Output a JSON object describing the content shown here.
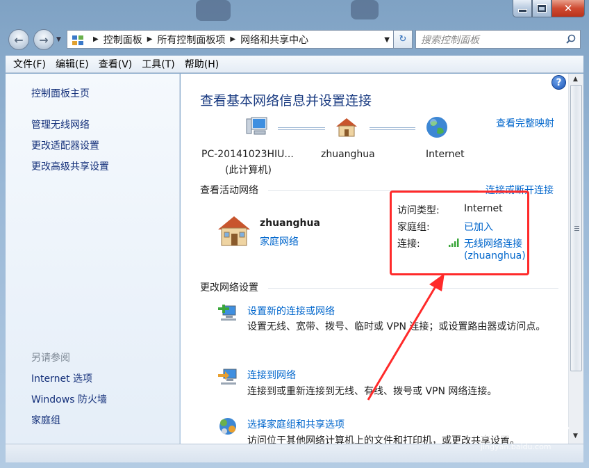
{
  "window": {
    "close_glyph": "✕"
  },
  "nav": {
    "back_glyph": "←",
    "forward_glyph": "→",
    "breadcrumbs": [
      "控制面板",
      "所有控制面板项",
      "网络和共享中心"
    ],
    "search_placeholder": "搜索控制面板",
    "refresh_glyph": "↻"
  },
  "menu": [
    "文件(F)",
    "编辑(E)",
    "查看(V)",
    "工具(T)",
    "帮助(H)"
  ],
  "sidebar": {
    "home": "控制面板主页",
    "links": [
      "管理无线网络",
      "更改适配器设置",
      "更改高级共享设置"
    ],
    "see_also_header": "另请参阅",
    "see_also": [
      "Internet 选项",
      "Windows 防火墙",
      "家庭组"
    ]
  },
  "main": {
    "title": "查看基本网络信息并设置连接",
    "full_map_link": "查看完整映射",
    "help_glyph": "?",
    "map": {
      "computer_name": "PC-20141023HIU...",
      "computer_sub": "(此计算机)",
      "network_name": "zhuanghua",
      "internet_label": "Internet"
    },
    "active": {
      "header": "查看活动网络",
      "connect_link": "连接或断开连接",
      "network_name": "zhuanghua",
      "network_type": "家庭网络",
      "access_type_label": "访问类型:",
      "access_type_value": "Internet",
      "homegroup_label": "家庭组:",
      "homegroup_value": "已加入",
      "connection_label": "连接:",
      "connection_value_1": "无线网络连接",
      "connection_value_2": "(zhuanghua)"
    },
    "change": {
      "header": "更改网络设置",
      "tasks": [
        {
          "title": "设置新的连接或网络",
          "desc": "设置无线、宽带、拨号、临时或 VPN 连接；或设置路由器或访问点。"
        },
        {
          "title": "连接到网络",
          "desc": "连接到或重新连接到无线、有线、拨号或 VPN 网络连接。"
        },
        {
          "title": "选择家庭组和共享选项",
          "desc": "访问位于其他网络计算机上的文件和打印机，或更改共享设置。"
        }
      ]
    }
  },
  "watermark": {
    "brand": "Baidu 经验",
    "url": "jingyan.baidu.com"
  },
  "colors": {
    "link": "#0066cc",
    "title": "#1b3c82",
    "annotation_red": "#ff2a2a"
  }
}
